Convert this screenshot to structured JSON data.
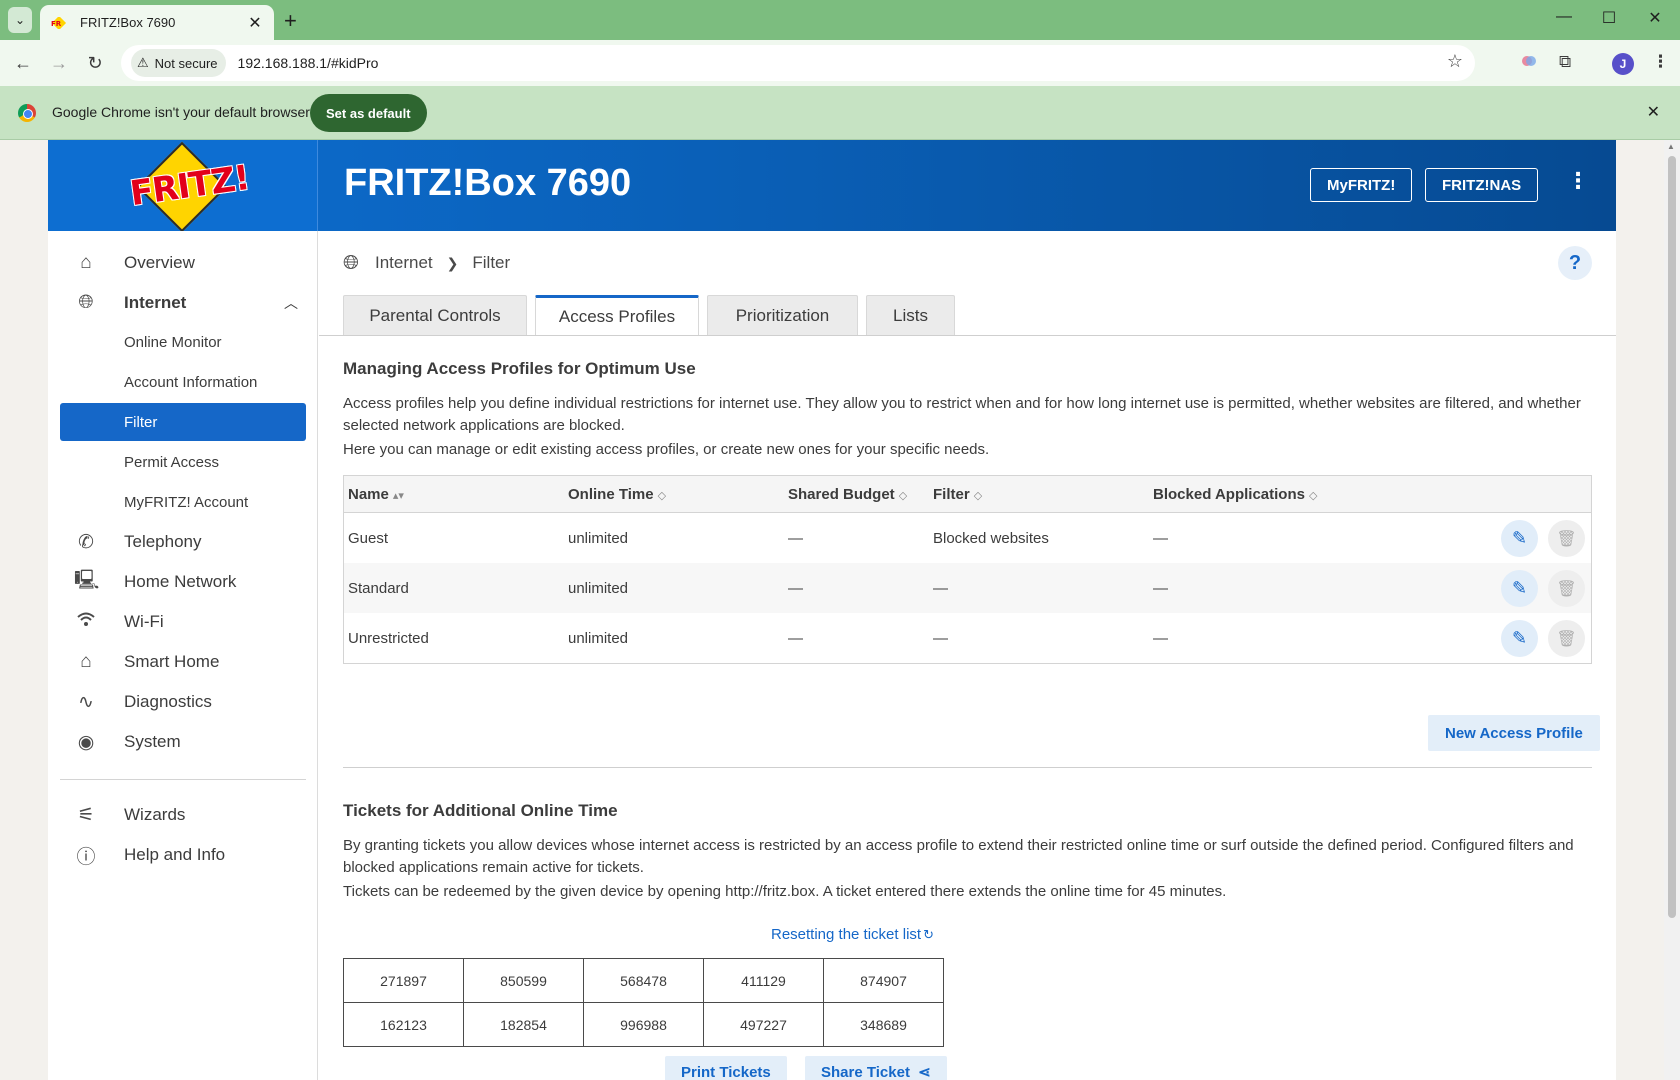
{
  "browser": {
    "tab_title": "FRITZ!Box 7690",
    "new_tab_icon": "+",
    "not_secure_label": "Not secure",
    "url": "192.168.188.1/#kidPro",
    "avatar_letter": "J",
    "infobar_text": "Google Chrome isn't your default browser",
    "set_default_label": "Set as default"
  },
  "header": {
    "logo_text": "FRITZ!",
    "title": "FRITZ!Box 7690",
    "myfritz_label": "MyFRITZ!",
    "fritznas_label": "FRITZ!NAS"
  },
  "sidebar": {
    "items": [
      {
        "label": "Overview",
        "icon": "home-icon"
      },
      {
        "label": "Internet",
        "icon": "globe-icon"
      },
      {
        "label": "Online Monitor"
      },
      {
        "label": "Account Information"
      },
      {
        "label": "Filter"
      },
      {
        "label": "Permit Access"
      },
      {
        "label": "MyFRITZ! Account"
      },
      {
        "label": "Telephony",
        "icon": "phone-icon"
      },
      {
        "label": "Home Network",
        "icon": "network-icon"
      },
      {
        "label": "Wi-Fi",
        "icon": "wifi-icon"
      },
      {
        "label": "Smart Home",
        "icon": "smart-home-icon"
      },
      {
        "label": "Diagnostics",
        "icon": "diagnostics-icon"
      },
      {
        "label": "System",
        "icon": "system-icon"
      },
      {
        "label": "Wizards",
        "icon": "wizard-icon"
      },
      {
        "label": "Help and Info",
        "icon": "help-icon"
      }
    ]
  },
  "breadcrumb": {
    "root": "Internet",
    "current": "Filter"
  },
  "tabs": [
    "Parental Controls",
    "Access Profiles",
    "Prioritization",
    "Lists"
  ],
  "active_tab": "Access Profiles",
  "profiles_section": {
    "title": "Managing Access Profiles for Optimum Use",
    "para1": "Access profiles help you define individual restrictions for internet use. They allow you to restrict when and for how long internet use is permitted, whether websites are filtered, and whether selected network applications are blocked.",
    "para2": "Here you can manage or edit existing access profiles, or create new ones for your specific needs.",
    "columns": [
      "Name",
      "Online Time",
      "Shared Budget",
      "Filter",
      "Blocked Applications"
    ],
    "rows": [
      [
        "Guest",
        "unlimited",
        "—",
        "Blocked websites",
        "—"
      ],
      [
        "Standard",
        "unlimited",
        "—",
        "—",
        "—"
      ],
      [
        "Unrestricted",
        "unlimited",
        "—",
        "—",
        "—"
      ]
    ],
    "new_profile_label": "New Access Profile"
  },
  "tickets_section": {
    "title": "Tickets for Additional Online Time",
    "para1": "By granting tickets you allow devices whose internet access is restricted by an access profile to extend their restricted online time or surf outside the defined period. Configured filters and blocked applications remain active for tickets.",
    "para2": "Tickets can be redeemed by the given device by opening http://fritz.box. A ticket entered there extends the online time for 45 minutes.",
    "reset_label": "Resetting the ticket list",
    "tickets": [
      [
        "271897",
        "850599",
        "568478",
        "411129",
        "874907"
      ],
      [
        "162123",
        "182854",
        "996988",
        "497227",
        "348689"
      ]
    ],
    "print_label": "Print Tickets",
    "share_label": "Share Ticket"
  },
  "colors": {
    "accent": "#1567c8",
    "header": "#0d6ed1",
    "tabbar": "#7cbd7f"
  }
}
